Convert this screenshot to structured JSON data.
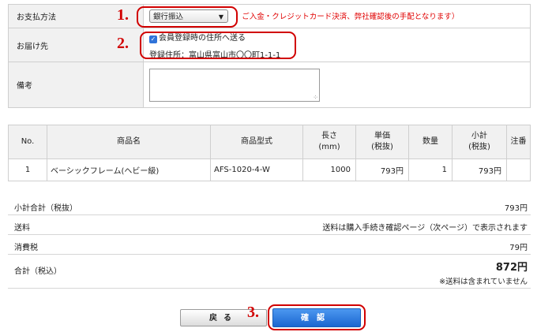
{
  "payment": {
    "label": "お支払方法",
    "selected": "銀行振込",
    "note": "ご入金・クレジットカード決済、弊社確認後の手配となります）"
  },
  "delivery": {
    "label": "お届け先",
    "checkbox_label": "会員登録時の住所へ送る",
    "registered_address": "登録住所：富山県富山市〇〇町1-1-1"
  },
  "remarks": {
    "label": "備考",
    "value": ""
  },
  "products": {
    "headers": {
      "no": "No.",
      "name": "商品名",
      "model": "商品型式",
      "length_1": "長さ",
      "length_2": "(mm)",
      "unit_price_1": "単価",
      "unit_price_2": "(税抜)",
      "quantity": "数量",
      "subtotal_1": "小計",
      "subtotal_2": "(税抜)",
      "notes": "注番"
    },
    "rows": [
      {
        "no": "1",
        "name": "ベーシックフレーム(ヘビー級)",
        "model": "AFS-1020-4-W",
        "length": "1000",
        "unit_price": "793円",
        "quantity": "1",
        "subtotal": "793円",
        "notes": ""
      }
    ]
  },
  "summary": {
    "subtotal_label": "小計合計（税抜）",
    "subtotal_value": "793円",
    "shipping_label": "送料",
    "shipping_value": "送料は購入手続き確認ページ（次ページ）で表示されます",
    "tax_label": "消費税",
    "tax_value": "79円",
    "total_label": "合計（税込）",
    "total_value": "872円",
    "total_note": "※送料は含まれていません"
  },
  "buttons": {
    "back": "戻る",
    "confirm": "確認"
  },
  "annotations": {
    "one": "1.",
    "two": "2.",
    "three": "3.",
    "color": "#d10000"
  }
}
